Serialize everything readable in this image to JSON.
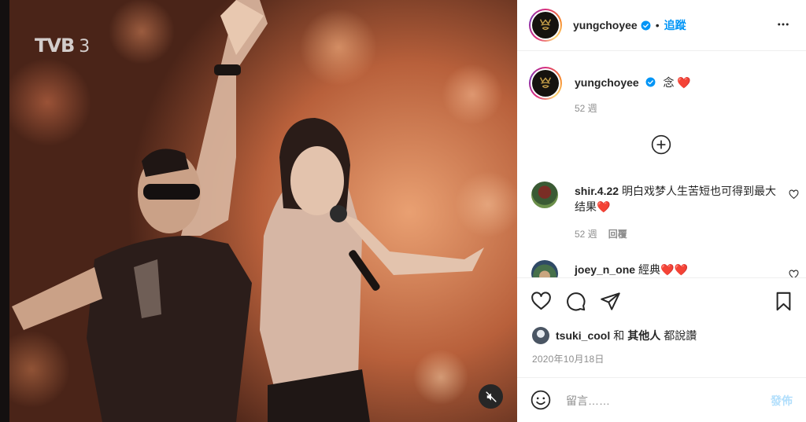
{
  "media": {
    "channel_logo": "TVB",
    "channel_number": "3",
    "mute_icon": "speaker-muted-icon"
  },
  "post": {
    "author": "yungchoyee",
    "follow_label": "追蹤",
    "separator": "•",
    "caption_text": "念",
    "caption_emoji": "❤️",
    "caption_age": "52 週",
    "date": "2020年10月18日"
  },
  "comments": [
    {
      "user": "shir.4.22",
      "text": "明白戏梦人生苦短也可得到最大结果",
      "emoji": "❤️",
      "age": "52 週",
      "reply_label": "回覆"
    },
    {
      "user": "joey_n_one",
      "text": "經典",
      "emoji": "❤️❤️",
      "age": "",
      "reply_label": ""
    }
  ],
  "likes": {
    "user": "tsuki_cool",
    "connector": "和",
    "others": "其他人",
    "suffix": "都說讚"
  },
  "composer": {
    "placeholder": "留言……",
    "post_label": "發佈"
  },
  "colors": {
    "accent": "#0095f6",
    "heart_red": "#ed4956",
    "post_disabled": "#b2dffc"
  }
}
